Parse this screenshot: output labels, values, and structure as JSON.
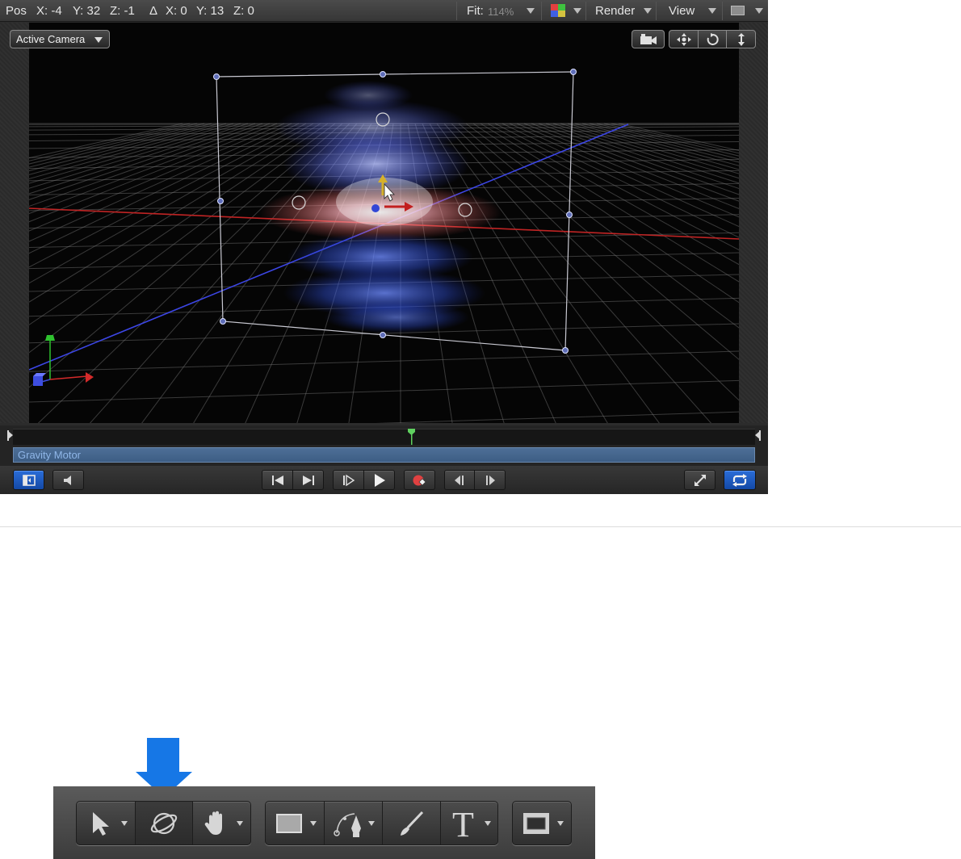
{
  "status_bar": {
    "pos_label": "Pos",
    "x": "X: -4",
    "y": "Y: 32",
    "z": "Z: -1",
    "delta_label": "Δ",
    "dx": "X: 0",
    "dy": "Y: 13",
    "dz": "Z: 0",
    "fit_label": "Fit:",
    "fit_value": "114%",
    "render_label": "Render",
    "view_label": "View"
  },
  "viewport": {
    "camera_menu": "Active Camera",
    "camera_menu_options": [
      "Active Camera"
    ],
    "grid": true
  },
  "timeline": {
    "bar_label": "Gravity Motor",
    "playhead_fraction": 0.537
  },
  "colors": {
    "accent_blue": "#1a5fd0",
    "axis_red": "#d42a2a",
    "axis_green": "#2fc22f",
    "axis_blue": "#3d4de0",
    "timeline_bar": "#4a6a92",
    "callout_arrow": "#1677e6"
  },
  "toolbar": {
    "icons": [
      "select-transform-icon",
      "3d-transform-icon",
      "pan-hand-icon",
      "rectangle-shape-icon",
      "bezier-pen-icon",
      "paint-stroke-icon",
      "text-icon",
      "mask-rectangle-icon"
    ]
  }
}
